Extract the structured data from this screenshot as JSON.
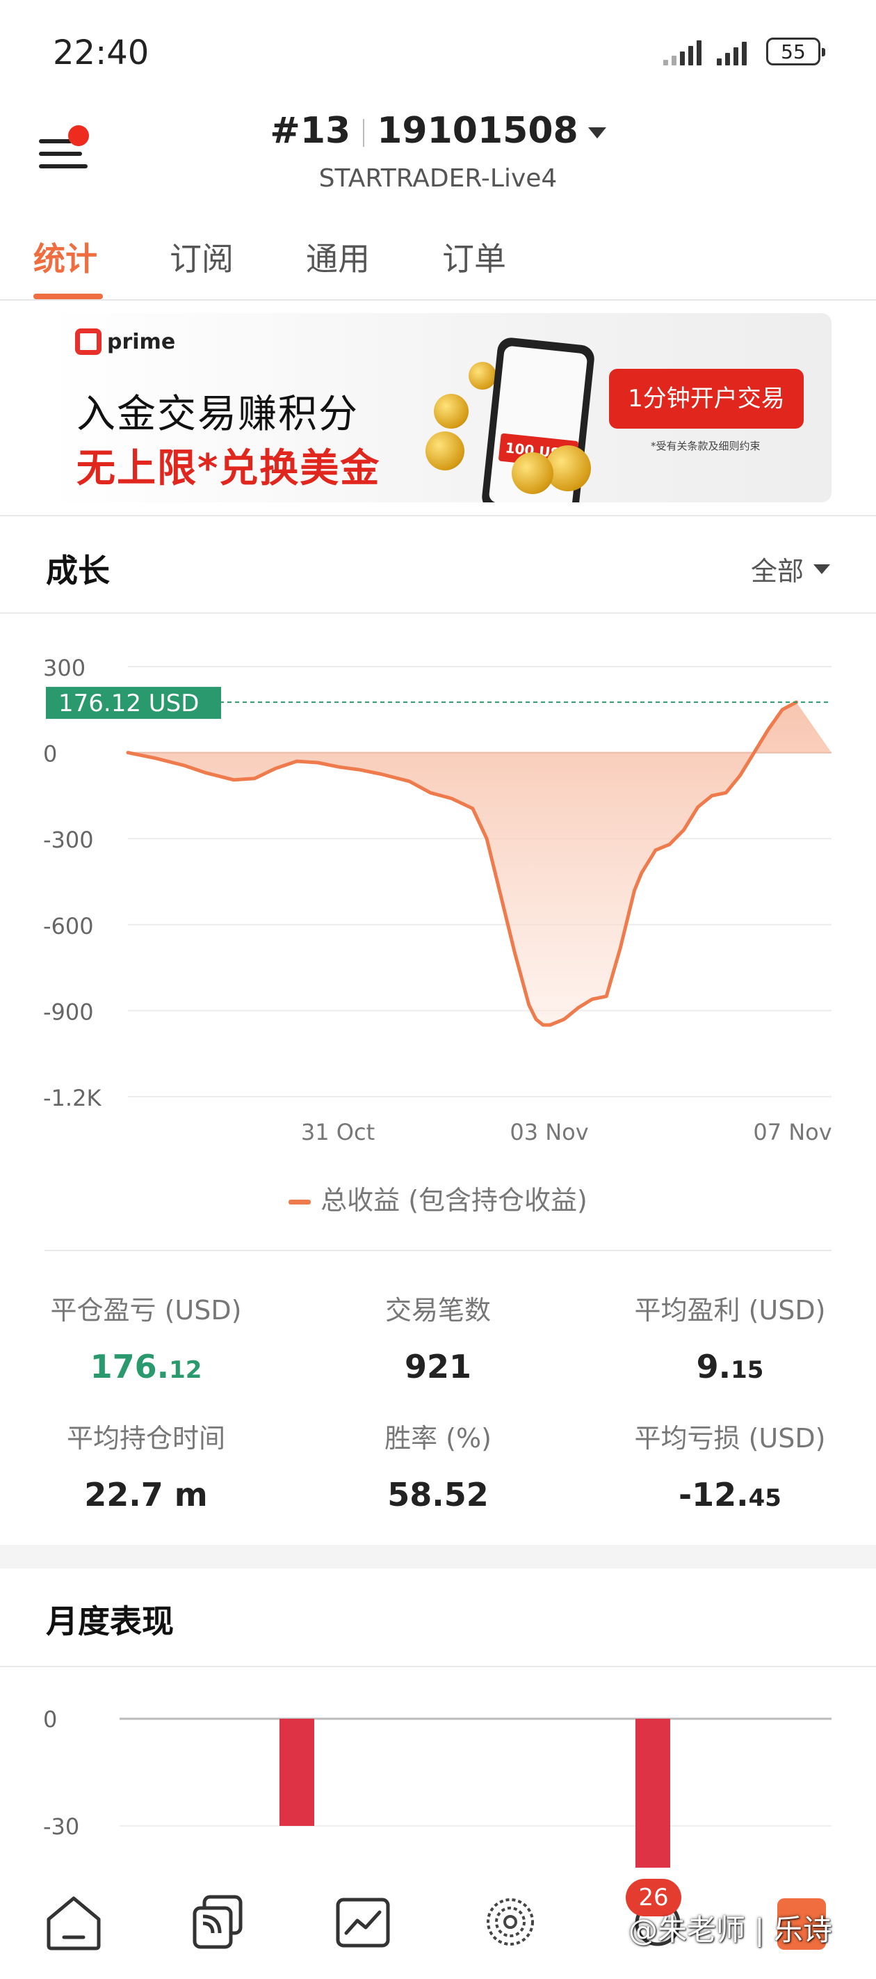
{
  "status_bar": {
    "time": "22:40",
    "battery": "55"
  },
  "header": {
    "account_number": "#13",
    "account_id": "19101508",
    "server": "STARTRADER-Live4"
  },
  "tabs": [
    {
      "label": "统计",
      "active": true
    },
    {
      "label": "订阅",
      "active": false
    },
    {
      "label": "通用",
      "active": false
    },
    {
      "label": "订单",
      "active": false
    }
  ],
  "banner": {
    "brand": "prime",
    "line1": "入金交易赚积分",
    "line2": "无上限*兑换美金",
    "phone_tag": "100 USD",
    "cta": "1分钟开户交易",
    "fine_print": "*受有关条款及细则约束"
  },
  "growth": {
    "title": "成长",
    "filter": "全部",
    "legend": "总收益 (包含持仓收益)",
    "current_label": "176.12 USD"
  },
  "chart_data": [
    {
      "type": "area",
      "title": "成长",
      "y_ticks": [
        "300",
        "0",
        "-300",
        "-600",
        "-900",
        "-1.2K"
      ],
      "ylim": [
        -1200,
        300
      ],
      "x_ticks": [
        "31 Oct",
        "03 Nov",
        "07 Nov"
      ],
      "x": [
        0,
        0.04,
        0.08,
        0.11,
        0.15,
        0.18,
        0.21,
        0.24,
        0.27,
        0.3,
        0.33,
        0.36,
        0.4,
        0.43,
        0.46,
        0.49,
        0.51,
        0.53,
        0.55,
        0.57,
        0.58,
        0.59,
        0.6,
        0.62,
        0.64,
        0.66,
        0.68,
        0.7,
        0.72,
        0.73,
        0.75,
        0.77,
        0.79,
        0.81,
        0.83,
        0.85,
        0.87,
        0.89,
        0.91,
        0.93,
        0.95,
        0.97,
        1.0
      ],
      "values": [
        0,
        -20,
        -45,
        -70,
        -95,
        -90,
        -55,
        -30,
        -35,
        -50,
        -60,
        -75,
        -100,
        -140,
        -160,
        -195,
        -300,
        -500,
        -700,
        -880,
        -930,
        -950,
        -950,
        -930,
        -890,
        -860,
        -850,
        -680,
        -480,
        -420,
        -340,
        -320,
        -270,
        -190,
        -150,
        -140,
        -80,
        0,
        80,
        150,
        176
      ],
      "annotation": "176.12 USD",
      "legend": "总收益 (包含持仓收益)"
    },
    {
      "type": "bar",
      "title": "月度表现",
      "y_ticks": [
        "0",
        "-30"
      ],
      "ylim": [
        -40,
        0
      ],
      "values": [
        -30,
        -43
      ]
    }
  ],
  "stats": [
    {
      "label": "平仓盈亏 (USD)",
      "int": "176.",
      "frac": "12",
      "color": "#2a9a6e"
    },
    {
      "label": "交易笔数",
      "int": "921",
      "frac": ""
    },
    {
      "label": "平均盈利 (USD)",
      "int": "9.",
      "frac": "15"
    },
    {
      "label": "平均持仓时间",
      "int": "22.7 m",
      "frac": ""
    },
    {
      "label": "胜率 (%)",
      "int": "58.52",
      "frac": ""
    },
    {
      "label": "平均亏损 (USD)",
      "int": "-12.",
      "frac": "45"
    }
  ],
  "monthly": {
    "title": "月度表现"
  },
  "bottom_nav": {
    "items": [
      "home-icon",
      "copy-trade-icon",
      "chart-icon",
      "discover-icon",
      "message-icon",
      "profile-icon"
    ],
    "badge": "26"
  },
  "watermark": "@朱老师 | 乐诗",
  "colors": {
    "accent": "#ef6d3e",
    "positive": "#2a9a6e",
    "negative": "#dd3344",
    "area": "#ef7b4d"
  }
}
